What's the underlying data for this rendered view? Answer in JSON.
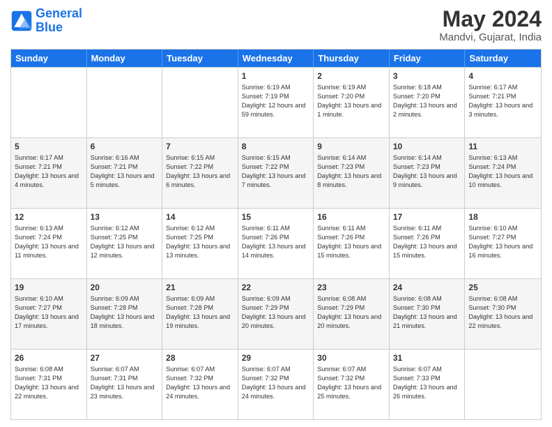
{
  "header": {
    "logo_line1": "General",
    "logo_line2": "Blue",
    "month": "May 2024",
    "location": "Mandvi, Gujarat, India"
  },
  "weekdays": [
    "Sunday",
    "Monday",
    "Tuesday",
    "Wednesday",
    "Thursday",
    "Friday",
    "Saturday"
  ],
  "rows": [
    [
      {
        "day": "",
        "sunrise": "",
        "sunset": "",
        "daylight": ""
      },
      {
        "day": "",
        "sunrise": "",
        "sunset": "",
        "daylight": ""
      },
      {
        "day": "",
        "sunrise": "",
        "sunset": "",
        "daylight": ""
      },
      {
        "day": "1",
        "sunrise": "Sunrise: 6:19 AM",
        "sunset": "Sunset: 7:19 PM",
        "daylight": "Daylight: 12 hours and 59 minutes."
      },
      {
        "day": "2",
        "sunrise": "Sunrise: 6:19 AM",
        "sunset": "Sunset: 7:20 PM",
        "daylight": "Daylight: 13 hours and 1 minute."
      },
      {
        "day": "3",
        "sunrise": "Sunrise: 6:18 AM",
        "sunset": "Sunset: 7:20 PM",
        "daylight": "Daylight: 13 hours and 2 minutes."
      },
      {
        "day": "4",
        "sunrise": "Sunrise: 6:17 AM",
        "sunset": "Sunset: 7:21 PM",
        "daylight": "Daylight: 13 hours and 3 minutes."
      }
    ],
    [
      {
        "day": "5",
        "sunrise": "Sunrise: 6:17 AM",
        "sunset": "Sunset: 7:21 PM",
        "daylight": "Daylight: 13 hours and 4 minutes."
      },
      {
        "day": "6",
        "sunrise": "Sunrise: 6:16 AM",
        "sunset": "Sunset: 7:21 PM",
        "daylight": "Daylight: 13 hours and 5 minutes."
      },
      {
        "day": "7",
        "sunrise": "Sunrise: 6:15 AM",
        "sunset": "Sunset: 7:22 PM",
        "daylight": "Daylight: 13 hours and 6 minutes."
      },
      {
        "day": "8",
        "sunrise": "Sunrise: 6:15 AM",
        "sunset": "Sunset: 7:22 PM",
        "daylight": "Daylight: 13 hours and 7 minutes."
      },
      {
        "day": "9",
        "sunrise": "Sunrise: 6:14 AM",
        "sunset": "Sunset: 7:23 PM",
        "daylight": "Daylight: 13 hours and 8 minutes."
      },
      {
        "day": "10",
        "sunrise": "Sunrise: 6:14 AM",
        "sunset": "Sunset: 7:23 PM",
        "daylight": "Daylight: 13 hours and 9 minutes."
      },
      {
        "day": "11",
        "sunrise": "Sunrise: 6:13 AM",
        "sunset": "Sunset: 7:24 PM",
        "daylight": "Daylight: 13 hours and 10 minutes."
      }
    ],
    [
      {
        "day": "12",
        "sunrise": "Sunrise: 6:13 AM",
        "sunset": "Sunset: 7:24 PM",
        "daylight": "Daylight: 13 hours and 11 minutes."
      },
      {
        "day": "13",
        "sunrise": "Sunrise: 6:12 AM",
        "sunset": "Sunset: 7:25 PM",
        "daylight": "Daylight: 13 hours and 12 minutes."
      },
      {
        "day": "14",
        "sunrise": "Sunrise: 6:12 AM",
        "sunset": "Sunset: 7:25 PM",
        "daylight": "Daylight: 13 hours and 13 minutes."
      },
      {
        "day": "15",
        "sunrise": "Sunrise: 6:11 AM",
        "sunset": "Sunset: 7:26 PM",
        "daylight": "Daylight: 13 hours and 14 minutes."
      },
      {
        "day": "16",
        "sunrise": "Sunrise: 6:11 AM",
        "sunset": "Sunset: 7:26 PM",
        "daylight": "Daylight: 13 hours and 15 minutes."
      },
      {
        "day": "17",
        "sunrise": "Sunrise: 6:11 AM",
        "sunset": "Sunset: 7:26 PM",
        "daylight": "Daylight: 13 hours and 15 minutes."
      },
      {
        "day": "18",
        "sunrise": "Sunrise: 6:10 AM",
        "sunset": "Sunset: 7:27 PM",
        "daylight": "Daylight: 13 hours and 16 minutes."
      }
    ],
    [
      {
        "day": "19",
        "sunrise": "Sunrise: 6:10 AM",
        "sunset": "Sunset: 7:27 PM",
        "daylight": "Daylight: 13 hours and 17 minutes."
      },
      {
        "day": "20",
        "sunrise": "Sunrise: 6:09 AM",
        "sunset": "Sunset: 7:28 PM",
        "daylight": "Daylight: 13 hours and 18 minutes."
      },
      {
        "day": "21",
        "sunrise": "Sunrise: 6:09 AM",
        "sunset": "Sunset: 7:28 PM",
        "daylight": "Daylight: 13 hours and 19 minutes."
      },
      {
        "day": "22",
        "sunrise": "Sunrise: 6:09 AM",
        "sunset": "Sunset: 7:29 PM",
        "daylight": "Daylight: 13 hours and 20 minutes."
      },
      {
        "day": "23",
        "sunrise": "Sunrise: 6:08 AM",
        "sunset": "Sunset: 7:29 PM",
        "daylight": "Daylight: 13 hours and 20 minutes."
      },
      {
        "day": "24",
        "sunrise": "Sunrise: 6:08 AM",
        "sunset": "Sunset: 7:30 PM",
        "daylight": "Daylight: 13 hours and 21 minutes."
      },
      {
        "day": "25",
        "sunrise": "Sunrise: 6:08 AM",
        "sunset": "Sunset: 7:30 PM",
        "daylight": "Daylight: 13 hours and 22 minutes."
      }
    ],
    [
      {
        "day": "26",
        "sunrise": "Sunrise: 6:08 AM",
        "sunset": "Sunset: 7:31 PM",
        "daylight": "Daylight: 13 hours and 22 minutes."
      },
      {
        "day": "27",
        "sunrise": "Sunrise: 6:07 AM",
        "sunset": "Sunset: 7:31 PM",
        "daylight": "Daylight: 13 hours and 23 minutes."
      },
      {
        "day": "28",
        "sunrise": "Sunrise: 6:07 AM",
        "sunset": "Sunset: 7:32 PM",
        "daylight": "Daylight: 13 hours and 24 minutes."
      },
      {
        "day": "29",
        "sunrise": "Sunrise: 6:07 AM",
        "sunset": "Sunset: 7:32 PM",
        "daylight": "Daylight: 13 hours and 24 minutes."
      },
      {
        "day": "30",
        "sunrise": "Sunrise: 6:07 AM",
        "sunset": "Sunset: 7:32 PM",
        "daylight": "Daylight: 13 hours and 25 minutes."
      },
      {
        "day": "31",
        "sunrise": "Sunrise: 6:07 AM",
        "sunset": "Sunset: 7:33 PM",
        "daylight": "Daylight: 13 hours and 26 minutes."
      },
      {
        "day": "",
        "sunrise": "",
        "sunset": "",
        "daylight": ""
      }
    ]
  ]
}
